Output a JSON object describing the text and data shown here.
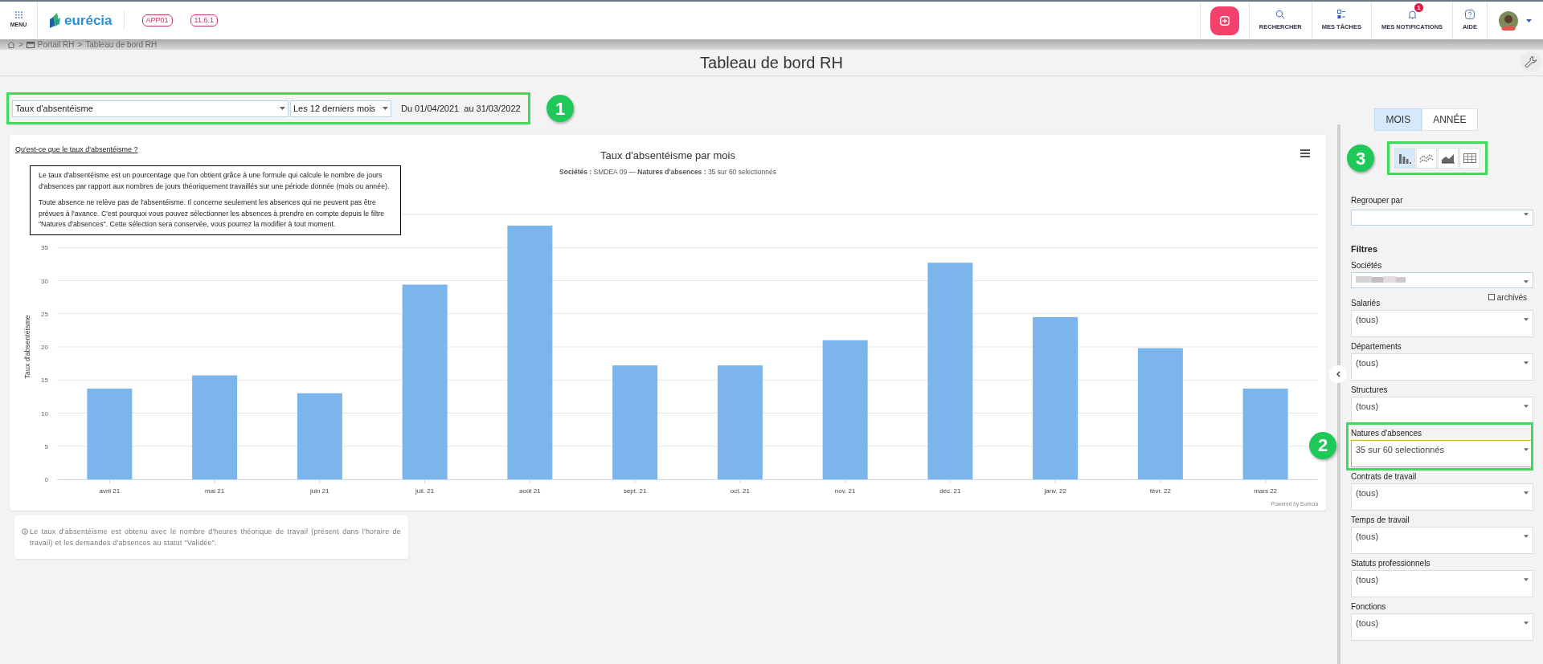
{
  "header": {
    "menu_label": "MENU",
    "logo_text": "eurécia",
    "badges": [
      "APP01",
      "11.6.1"
    ],
    "actions": [
      {
        "kind": "search",
        "label": "RECHERCHER"
      },
      {
        "kind": "tasks",
        "label": "MES TÂCHES"
      },
      {
        "kind": "notifications",
        "label": "MES NOTIFICATIONS",
        "badge": "1"
      },
      {
        "kind": "help",
        "label": "AIDE"
      }
    ]
  },
  "breadcrumb": {
    "separator": ">",
    "items": [
      "Portail RH",
      "Tableau de bord RH"
    ]
  },
  "page_title": "Tableau de bord RH",
  "filter_bar": {
    "indicator": "Taux d'absentéisme",
    "period": "Les 12 derniers mois",
    "date_range": "Du 01/04/2021  au 31/03/2022",
    "callout": "1"
  },
  "chart_card": {
    "help_link": "Qu'est-ce que le taux d'absentéisme ?",
    "title": "Taux d'absentéisme par mois",
    "subtitle": "**Sociétés :** SMDEA 09 — **Natures d'absences :** 35 sur 60 selectionnés",
    "tooltip": [
      "Le taux d'absentéisme est un pourcentage que l'on obtient grâce à une formule qui calcule le nombre de jours d'absences par rapport aux nombres de jours théoriquement travaillés sur une période donnée (mois ou année).",
      "Toute absence ne relève pas de l'absentéisme. Il concerne seulement les absences qui ne peuvent pas être prévues à l'avance. C'est pourquoi vous pouvez sélectionner les absences à prendre en compte depuis le filtre \"Natures d'absences\". Cette sélection sera conservée, vous pourrez la modifier à tout moment."
    ],
    "chart_data": {
      "type": "bar",
      "ylabel": "Taux d'absentéisme",
      "categories": [
        "avril 21",
        "mai 21",
        "juin 21",
        "juil. 21",
        "août 21",
        "sept. 21",
        "oct. 21",
        "nov. 21",
        "déc. 21",
        "janv. 22",
        "févr. 22",
        "mars 22"
      ],
      "series": [
        {
          "color": "#7cb5ec",
          "values": [
            13.7,
            15.7,
            13.0,
            29.4,
            38.3,
            17.2,
            17.2,
            21.0,
            32.7,
            24.5,
            19.8,
            13.7
          ]
        }
      ],
      "grid": true,
      "ylim": [
        0,
        40
      ],
      "yticks": [
        0,
        5,
        10,
        15,
        20,
        25,
        30,
        35
      ]
    },
    "credit": "Powered by Eurécia"
  },
  "note": "Le taux d'absentéisme est obtenu avec le nombre d'heures théorique de travail (présent dans l'horaire de travail) et les demandes d'absences au statut \"Validée\".",
  "side_panel": {
    "period_toggle": [
      {
        "label": "MOIS",
        "selected": true
      },
      {
        "label": "ANNÉE",
        "selected": false
      }
    ],
    "chart_types_callout": "3",
    "chart_types": [
      {
        "kind": "bar",
        "selected": true
      },
      {
        "kind": "line",
        "selected": false
      },
      {
        "kind": "area",
        "selected": false
      },
      {
        "kind": "table",
        "selected": false
      }
    ],
    "group_by_label": "Regrouper par",
    "filters_heading": "Filtres",
    "fields": [
      {
        "kind": "redacted",
        "label": "Sociétés",
        "highlighted": false
      },
      {
        "kind": "select",
        "label": "Salariés",
        "value": "(tous)",
        "highlighted": false,
        "checkbox": {
          "label": "archivés",
          "checked": false
        }
      },
      {
        "kind": "select",
        "label": "Départements",
        "value": "(tous)",
        "highlighted": false
      },
      {
        "kind": "select",
        "label": "Structures",
        "value": "(tous)",
        "highlighted": false
      },
      {
        "kind": "select",
        "label": "Natures d'absences",
        "value": "35 sur 60 selectionnés",
        "highlighted": true,
        "callout": "2"
      },
      {
        "kind": "select",
        "label": "Contrats de travail",
        "value": "(tous)",
        "highlighted": false
      },
      {
        "kind": "select",
        "label": "Temps de travail",
        "value": "(tous)",
        "highlighted": false
      },
      {
        "kind": "select",
        "label": "Statuts professionnels",
        "value": "(tous)",
        "highlighted": false
      },
      {
        "kind": "select",
        "label": "Fonctions",
        "value": "(tous)",
        "highlighted": false
      }
    ]
  }
}
